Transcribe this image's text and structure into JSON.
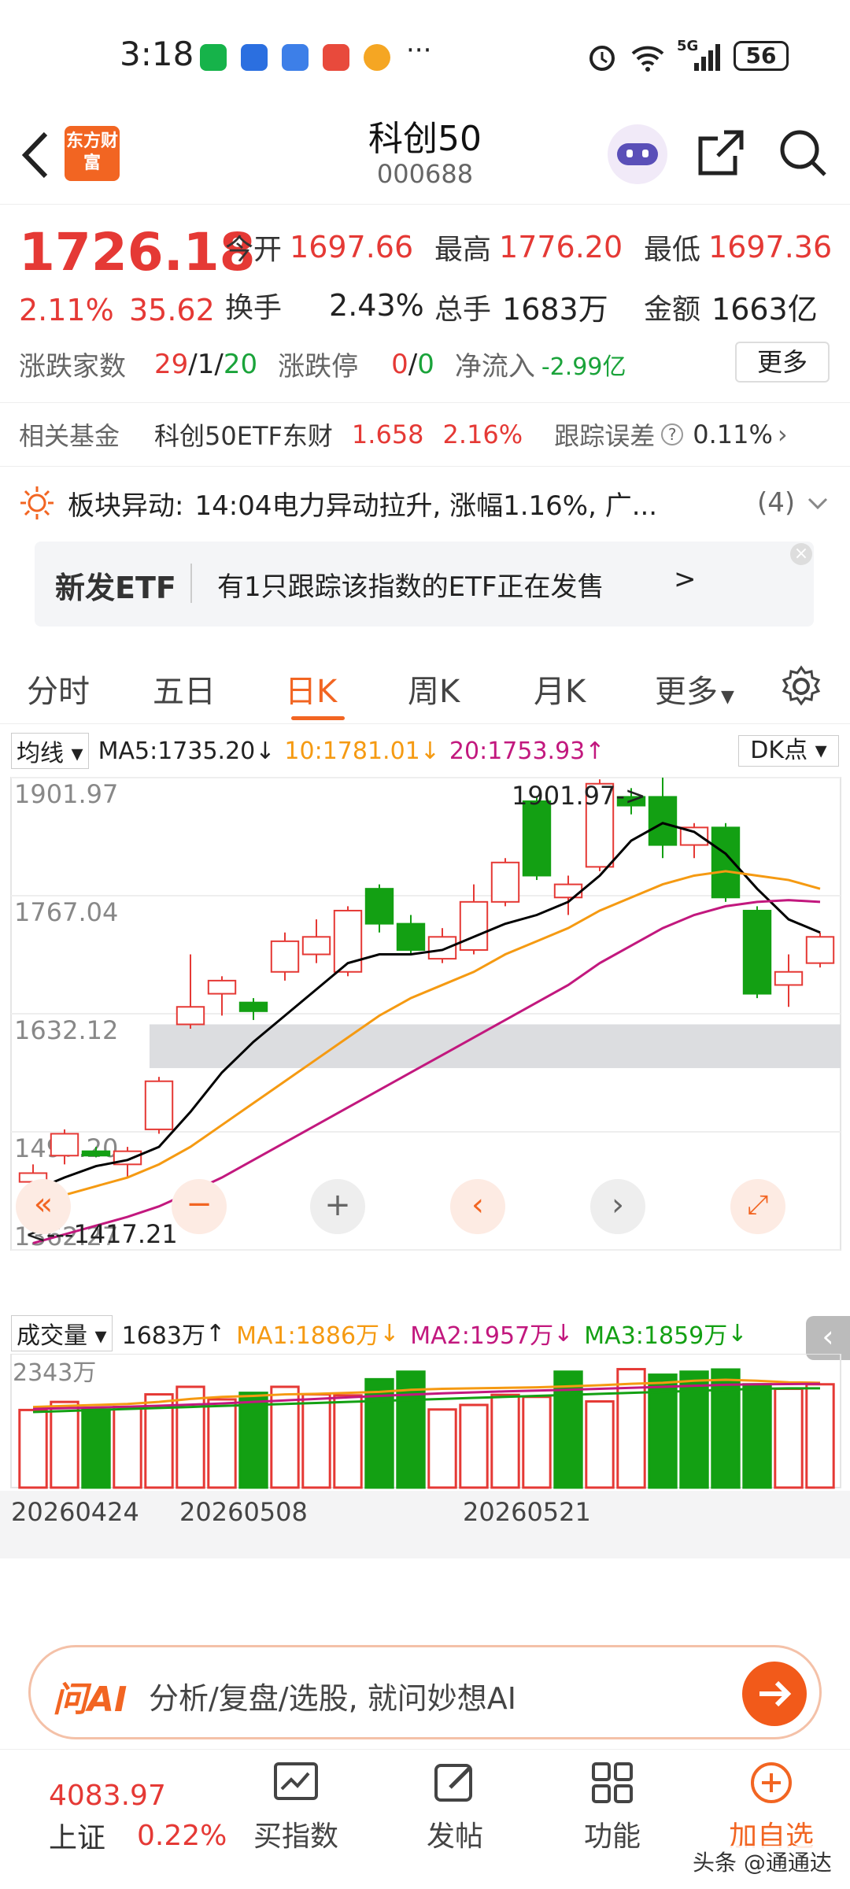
{
  "status": {
    "time": "3:18",
    "network": "5G",
    "battery": "56"
  },
  "header": {
    "back_icon": "chevron-left-icon",
    "logo_text": "东方财富",
    "title": "科创50",
    "code": "000688"
  },
  "quote": {
    "price": "1726.18",
    "pct": "2.11%",
    "chg": "35.62",
    "open_label": "今开",
    "open": "1697.66",
    "high_label": "最高",
    "high": "1776.20",
    "low_label": "最低",
    "low": "1697.36",
    "turnover_label": "换手",
    "turnover": "2.43%",
    "volume_label": "总手",
    "volume": "1683万",
    "amount_label": "金额",
    "amount": "1663亿",
    "breadth_label": "涨跌家数",
    "breadth_up": "29",
    "breadth_flat": "1",
    "breadth_down": "20",
    "limit_label": "涨跌停",
    "limit_up": "0",
    "limit_down": "0",
    "netflow_label": "净流入",
    "netflow": "-2.99亿",
    "more_button": "更多"
  },
  "fund": {
    "label": "相关基金",
    "name": "科创50ETF东财",
    "price": "1.658",
    "pct": "2.16%",
    "track_label": "跟踪误差",
    "track_value": "0.11%"
  },
  "alert": {
    "label": "板块异动:",
    "text": "14:04电力异动拉升, 涨幅1.16%, 广...",
    "count": "(4)"
  },
  "banner": {
    "tag": "新发ETF",
    "text": "有1只跟踪该指数的ETF正在发售",
    "arrow": ">"
  },
  "tabs": [
    "分时",
    "五日",
    "日K",
    "周K",
    "月K",
    "更多"
  ],
  "ma": {
    "selector": "均线",
    "ma5": "MA5:1735.20",
    "ma10": "10:1781.01",
    "ma20": "20:1753.93",
    "dk": "DK点"
  },
  "volbar": {
    "selector": "成交量",
    "vol": "1683万",
    "ma1": "MA1:1886万",
    "ma2": "MA2:1957万",
    "ma3": "MA3:1859万"
  },
  "chart_data": {
    "type": "candlestick",
    "y_ticks": [
      "1901.97",
      "1767.04",
      "1632.12",
      "1497.20",
      "1362.27"
    ],
    "ylim": [
      1362.27,
      1901.97
    ],
    "high_annotation": "1901.97->",
    "low_annotation": "<---1417.21",
    "x_labels": [
      "20260424",
      "20260508",
      "20260521"
    ],
    "candles": [
      {
        "o": 1440,
        "h": 1460,
        "l": 1420,
        "c": 1450,
        "up": true
      },
      {
        "o": 1470,
        "h": 1500,
        "l": 1460,
        "c": 1495,
        "up": true
      },
      {
        "o": 1475,
        "h": 1480,
        "l": 1468,
        "c": 1470,
        "up": false
      },
      {
        "o": 1460,
        "h": 1480,
        "l": 1445,
        "c": 1475,
        "up": true
      },
      {
        "o": 1500,
        "h": 1560,
        "l": 1495,
        "c": 1555,
        "up": true
      },
      {
        "o": 1620,
        "h": 1700,
        "l": 1615,
        "c": 1640,
        "up": true
      },
      {
        "o": 1655,
        "h": 1675,
        "l": 1630,
        "c": 1670,
        "up": true
      },
      {
        "o": 1645,
        "h": 1650,
        "l": 1625,
        "c": 1635,
        "up": false
      },
      {
        "o": 1680,
        "h": 1725,
        "l": 1670,
        "c": 1715,
        "up": true
      },
      {
        "o": 1700,
        "h": 1740,
        "l": 1690,
        "c": 1720,
        "up": true
      },
      {
        "o": 1680,
        "h": 1755,
        "l": 1675,
        "c": 1750,
        "up": true
      },
      {
        "o": 1775,
        "h": 1780,
        "l": 1725,
        "c": 1735,
        "up": false
      },
      {
        "o": 1735,
        "h": 1745,
        "l": 1700,
        "c": 1705,
        "up": false
      },
      {
        "o": 1695,
        "h": 1730,
        "l": 1690,
        "c": 1720,
        "up": true
      },
      {
        "o": 1705,
        "h": 1780,
        "l": 1700,
        "c": 1760,
        "up": true
      },
      {
        "o": 1760,
        "h": 1810,
        "l": 1755,
        "c": 1805,
        "up": true
      },
      {
        "o": 1875,
        "h": 1880,
        "l": 1785,
        "c": 1790,
        "up": false
      },
      {
        "o": 1765,
        "h": 1790,
        "l": 1745,
        "c": 1780,
        "up": true
      },
      {
        "o": 1800,
        "h": 1900,
        "l": 1795,
        "c": 1895,
        "up": true
      },
      {
        "o": 1880,
        "h": 1890,
        "l": 1860,
        "c": 1870,
        "up": false
      },
      {
        "o": 1880,
        "h": 1902,
        "l": 1810,
        "c": 1825,
        "up": false
      },
      {
        "o": 1825,
        "h": 1850,
        "l": 1810,
        "c": 1845,
        "up": true
      },
      {
        "o": 1845,
        "h": 1850,
        "l": 1760,
        "c": 1765,
        "up": false
      },
      {
        "o": 1750,
        "h": 1755,
        "l": 1650,
        "c": 1655,
        "up": false
      },
      {
        "o": 1665,
        "h": 1700,
        "l": 1640,
        "c": 1680,
        "up": true
      },
      {
        "o": 1690,
        "h": 1725,
        "l": 1685,
        "c": 1720,
        "up": true
      }
    ],
    "ma5": [
      1430,
      1445,
      1458,
      1465,
      1480,
      1520,
      1565,
      1600,
      1630,
      1660,
      1690,
      1700,
      1700,
      1705,
      1720,
      1735,
      1745,
      1760,
      1790,
      1830,
      1850,
      1840,
      1815,
      1775,
      1740,
      1725
    ],
    "ma10": [
      1415,
      1425,
      1435,
      1445,
      1460,
      1480,
      1505,
      1530,
      1555,
      1580,
      1605,
      1630,
      1650,
      1665,
      1680,
      1700,
      1715,
      1730,
      1750,
      1765,
      1780,
      1790,
      1795,
      1790,
      1785,
      1775
    ],
    "ma20": [
      1370,
      1380,
      1390,
      1400,
      1412,
      1428,
      1445,
      1465,
      1485,
      1505,
      1525,
      1545,
      1565,
      1585,
      1605,
      1625,
      1645,
      1665,
      1690,
      1710,
      1730,
      1745,
      1755,
      1760,
      1762,
      1760
    ],
    "band": [
      1570,
      1620
    ],
    "volume": {
      "ymax_label": "2343万",
      "ymax": 2343,
      "values": [
        1540,
        1700,
        1550,
        1600,
        1850,
        2000,
        1750,
        1880,
        2000,
        1850,
        1830,
        2150,
        2300,
        1550,
        1640,
        1840,
        1800,
        2300,
        1710,
        2350,
        2240,
        2300,
        2343,
        2050,
        1960,
        2050
      ],
      "up": [
        true,
        true,
        false,
        true,
        true,
        true,
        true,
        false,
        true,
        true,
        true,
        false,
        false,
        true,
        true,
        true,
        true,
        false,
        true,
        true,
        false,
        false,
        false,
        false,
        true,
        true
      ],
      "ma1": [
        1600,
        1620,
        1640,
        1660,
        1700,
        1760,
        1800,
        1820,
        1850,
        1860,
        1880,
        1900,
        1940,
        1960,
        1970,
        1980,
        1990,
        2010,
        2030,
        2060,
        2080,
        2120,
        2140,
        2120,
        2090,
        2080
      ],
      "ma2": [
        1560,
        1575,
        1590,
        1605,
        1625,
        1645,
        1670,
        1700,
        1730,
        1760,
        1790,
        1820,
        1845,
        1870,
        1890,
        1910,
        1925,
        1940,
        1960,
        1980,
        2000,
        2020,
        2040,
        2050,
        2055,
        2060
      ],
      "ma3": [
        1500,
        1520,
        1540,
        1560,
        1580,
        1600,
        1620,
        1640,
        1660,
        1680,
        1700,
        1720,
        1740,
        1760,
        1780,
        1800,
        1820,
        1840,
        1860,
        1880,
        1900,
        1920,
        1940,
        1960,
        1970,
        1970
      ]
    }
  },
  "ask": {
    "logo": "问AI",
    "placeholder": "分析/复盘/选股, 就问妙想AI"
  },
  "bottom": {
    "index_value": "4083.97",
    "index_name": "上证",
    "index_pct": "0.22%",
    "nav1": "买指数",
    "nav2": "发帖",
    "nav3": "功能",
    "nav4": "加自选"
  },
  "watermark": "头条 @通通达",
  "colors": {
    "up": "#e53935",
    "down": "#13a013",
    "ma5": "#000000",
    "ma10": "#f59a12",
    "ma20": "#c2187e",
    "accent": "#f26522"
  }
}
